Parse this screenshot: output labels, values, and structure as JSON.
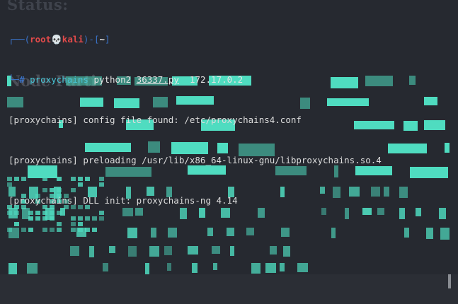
{
  "window": {
    "background": "#262930"
  },
  "ghost_text": {
    "status": "Status:",
    "node": "Node Parti"
  },
  "prompt": {
    "frame_top": "┌──(",
    "user": "root",
    "skull": "💀",
    "host": "kali",
    "sep": ")-[",
    "cwd": "~",
    "close": "]",
    "frame_bottom": "└─",
    "symbol": "#",
    "command": "proxychains",
    "interpreter": "python2",
    "script": "36337.py",
    "target": "172.17.0.2"
  },
  "output_lines": [
    "[proxychains] config file found: /etc/proxychains4.conf",
    "[proxychains] preloading /usr/lib/x86_64-linux-gnu/libproxychains.so.4",
    "[proxychains] DLL init: proxychains-ng 4.14"
  ],
  "colors": {
    "teal": "#4fdcc0",
    "prompt_blue": "#3a73c9",
    "root_red": "#e24a4a",
    "command_cyan": "#47c5d6"
  },
  "glitch_art": "binary garbage rendered as teal block characters"
}
